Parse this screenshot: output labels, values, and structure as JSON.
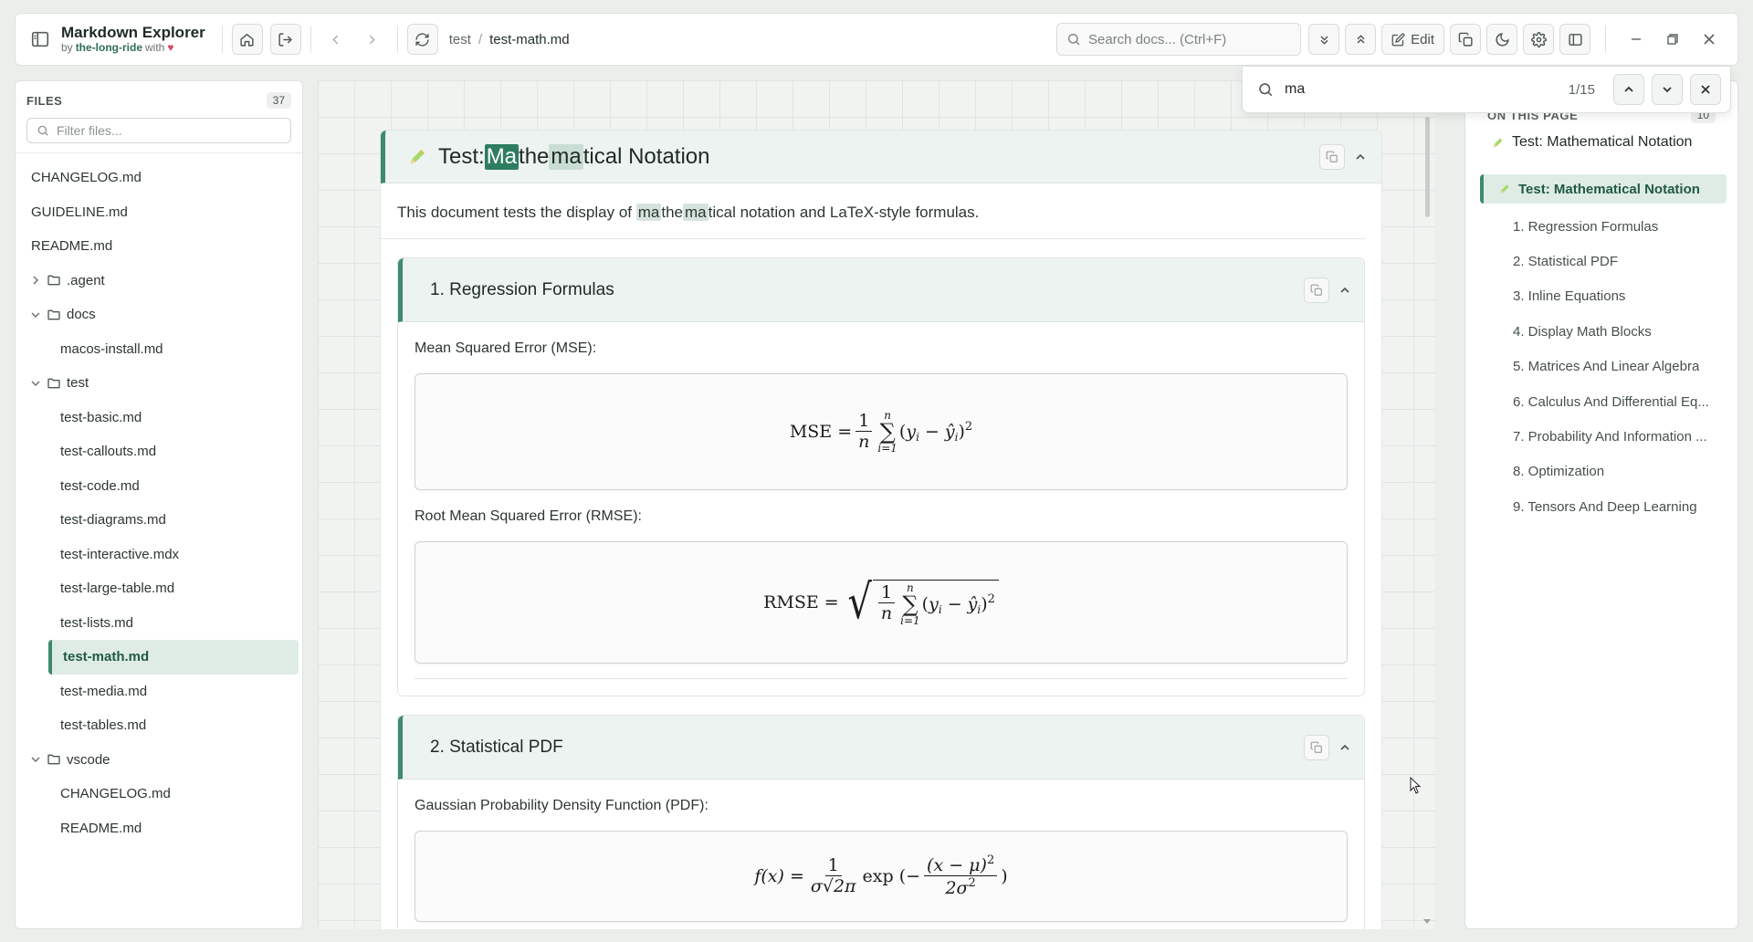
{
  "app": {
    "name": "Markdown Explorer",
    "byline_prefix": "by",
    "byline_author": "the-long-ride",
    "byline_suffix": "with"
  },
  "breadcrumb": {
    "folder": "test",
    "separator": "/",
    "file": "test-math.md"
  },
  "search": {
    "placeholder": "Search docs... (Ctrl+F)"
  },
  "toolbar": {
    "edit_label": "Edit"
  },
  "find": {
    "query": "ma",
    "count": "1/15"
  },
  "sidebar": {
    "title": "FILES",
    "count": "37",
    "filter_placeholder": "Filter files...",
    "items": [
      {
        "label": "CHANGELOG.md"
      },
      {
        "label": "GUIDELINE.md"
      },
      {
        "label": "README.md"
      },
      {
        "label": ".agent"
      },
      {
        "label": "docs"
      },
      {
        "label": "macos-install.md"
      },
      {
        "label": "test"
      },
      {
        "label": "test-basic.md"
      },
      {
        "label": "test-callouts.md"
      },
      {
        "label": "test-code.md"
      },
      {
        "label": "test-diagrams.md"
      },
      {
        "label": "test-interactive.mdx"
      },
      {
        "label": "test-large-table.md"
      },
      {
        "label": "test-lists.md"
      },
      {
        "label": "test-math.md"
      },
      {
        "label": "test-media.md"
      },
      {
        "label": "test-tables.md"
      },
      {
        "label": "vscode"
      },
      {
        "label": "CHANGELOG.md"
      },
      {
        "label": "README.md"
      }
    ]
  },
  "doc": {
    "title_prefix": "Test: ",
    "title_hl1": "Ma",
    "title_mid": "the",
    "title_hl2": "ma",
    "title_suffix": "tical Notation",
    "intro_before": "This document tests the display of ",
    "intro_hl1": "ma",
    "intro_mid": "the",
    "intro_hl2": "ma",
    "intro_after": "tical notation and LaTeX-style formulas.",
    "sections": [
      {
        "title": "1. Regression Formulas",
        "mse_label": "Mean Squared Error (MSE):",
        "rmse_label": "Root Mean Squared Error (RMSE):"
      },
      {
        "title": "2. Statistical PDF",
        "pdf_label": "Gaussian Probability Density Function (PDF):"
      }
    ],
    "math": {
      "mse_lhs": "MSE",
      "rmse_lhs": "RMSE",
      "pdf_lhs": "f(x)",
      "eq": "=",
      "one": "1",
      "n": "n",
      "i_eq_1": "i=1",
      "sigma_sym": "∑",
      "exp": "exp",
      "sigma_sqrt_2pi": "σ√2π",
      "x_minus_mu": "(x − μ)",
      "two_sigma": "2σ"
    }
  },
  "toc": {
    "title": "ON THIS PAGE",
    "count": "10",
    "current": "Test: Mathematical Notation",
    "items": [
      {
        "label": "Test: Mathematical Notation"
      },
      {
        "label": "1. Regression Formulas"
      },
      {
        "label": "2. Statistical PDF"
      },
      {
        "label": "3. Inline Equations"
      },
      {
        "label": "4. Display Math Blocks"
      },
      {
        "label": "5. Matrices And Linear Algebra"
      },
      {
        "label": "6. Calculus And Differential Eq..."
      },
      {
        "label": "7. Probability And Information ..."
      },
      {
        "label": "8. Optimization"
      },
      {
        "label": "9. Tensors And Deep Learning"
      }
    ]
  },
  "colors": {
    "accent": "#3e8a6c",
    "highlight_current": "#2f7d61",
    "highlight_match": "#c9ddd4",
    "heart": "#d6475a"
  }
}
